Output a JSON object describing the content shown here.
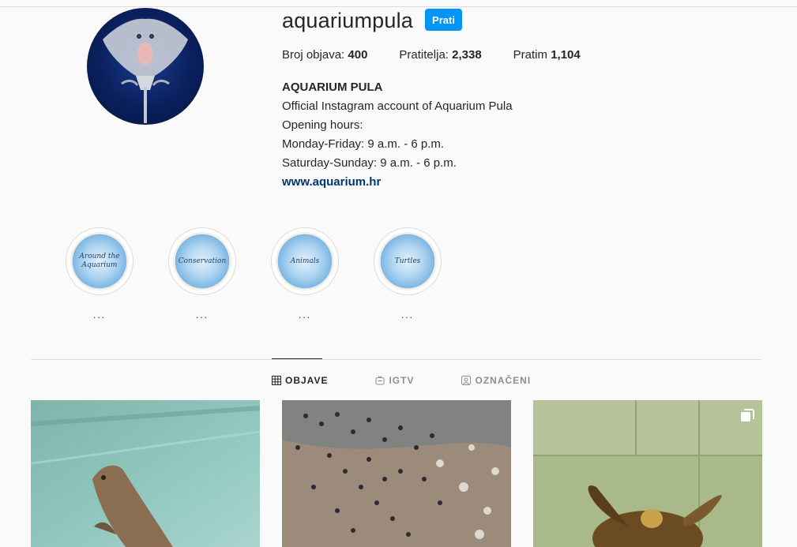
{
  "profile": {
    "username": "aquariumpula",
    "follow_label": "Prati",
    "stats": {
      "posts_label": "Broj objava:",
      "posts_value": "400",
      "followers_label": "Pratitelja:",
      "followers_value": "2,338",
      "following_label": "Pratim",
      "following_value": "1,104"
    },
    "bio": {
      "name": "AQUARIUM PULA",
      "lines": [
        "Official Instagram account of Aquarium Pula",
        "Opening hours:",
        "Monday-Friday: 9 a.m. - 6 p.m.",
        "Saturday-Sunday: 9 a.m. - 6 p.m."
      ],
      "link": "www.aquarium.hr"
    }
  },
  "highlights": [
    {
      "cover_text": "Around the Aquarium",
      "label": "..."
    },
    {
      "cover_text": "Conservation",
      "label": "..."
    },
    {
      "cover_text": "Animals",
      "label": "..."
    },
    {
      "cover_text": "Turtles",
      "label": "..."
    }
  ],
  "tabs": [
    {
      "label": "OBJAVE",
      "icon": "grid-icon",
      "active": true
    },
    {
      "label": "IGTV",
      "icon": "igtv-icon",
      "active": false
    },
    {
      "label": "OZNAČENI",
      "icon": "tagged-icon",
      "active": false
    }
  ],
  "colors": {
    "accent": "#0095f6",
    "link": "#00376b",
    "border": "#dbdbdb"
  }
}
